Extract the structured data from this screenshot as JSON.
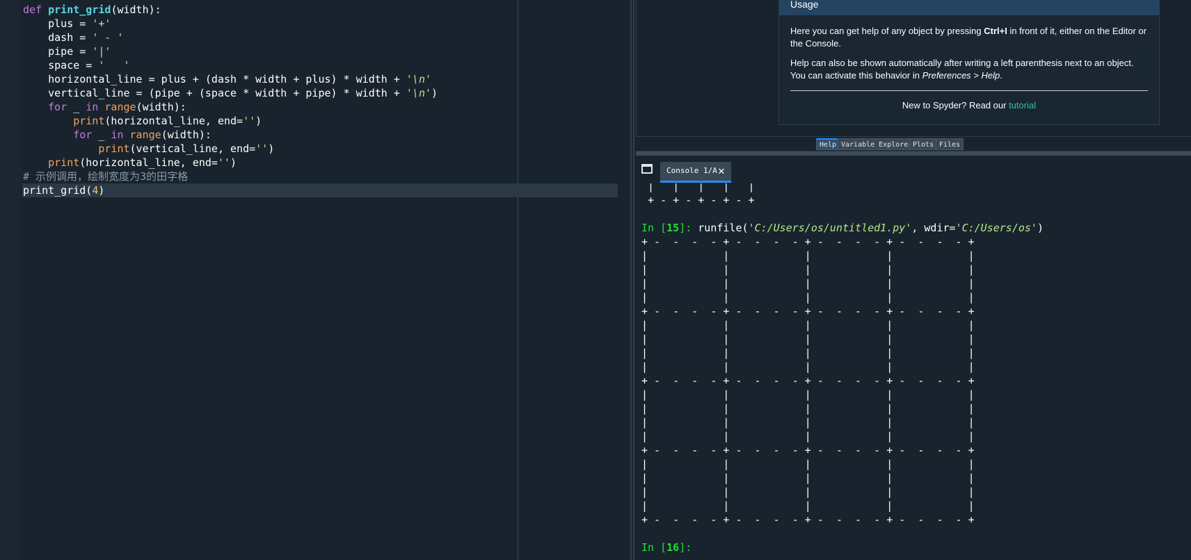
{
  "editor": {
    "lines": [
      [
        {
          "t": "def ",
          "c": "kw"
        },
        {
          "t": "print_grid",
          "c": "fn"
        },
        {
          "t": "(width):",
          "c": ""
        }
      ],
      [
        {
          "t": "    plus = ",
          "c": ""
        },
        {
          "t": "'+'",
          "c": "str"
        }
      ],
      [
        {
          "t": "    dash = ",
          "c": ""
        },
        {
          "t": "' - '",
          "c": "str"
        }
      ],
      [
        {
          "t": "    pipe = ",
          "c": ""
        },
        {
          "t": "'|'",
          "c": "str"
        }
      ],
      [
        {
          "t": "    space = ",
          "c": ""
        },
        {
          "t": "'   '",
          "c": "str"
        }
      ],
      [
        {
          "t": "    horizontal_line = plus + (dash * width + plus) * width + ",
          "c": ""
        },
        {
          "t": "'\\n'",
          "c": "str"
        }
      ],
      [
        {
          "t": "    vertical_line = (pipe + (space * width + pipe) * width + ",
          "c": ""
        },
        {
          "t": "'\\n'",
          "c": "str"
        },
        {
          "t": ")",
          "c": ""
        }
      ],
      [
        {
          "t": "    ",
          "c": ""
        },
        {
          "t": "for",
          "c": "kw"
        },
        {
          "t": " _ ",
          "c": ""
        },
        {
          "t": "in",
          "c": "kw"
        },
        {
          "t": " ",
          "c": ""
        },
        {
          "t": "range",
          "c": "bi"
        },
        {
          "t": "(width):",
          "c": ""
        }
      ],
      [
        {
          "t": "        ",
          "c": ""
        },
        {
          "t": "print",
          "c": "bi"
        },
        {
          "t": "(horizontal_line, end=",
          "c": ""
        },
        {
          "t": "''",
          "c": "str"
        },
        {
          "t": ")",
          "c": ""
        }
      ],
      [
        {
          "t": "        ",
          "c": ""
        },
        {
          "t": "for",
          "c": "kw"
        },
        {
          "t": " _ ",
          "c": ""
        },
        {
          "t": "in",
          "c": "kw"
        },
        {
          "t": " ",
          "c": ""
        },
        {
          "t": "range",
          "c": "bi"
        },
        {
          "t": "(width):",
          "c": ""
        }
      ],
      [
        {
          "t": "            ",
          "c": ""
        },
        {
          "t": "print",
          "c": "bi"
        },
        {
          "t": "(vertical_line, end=",
          "c": ""
        },
        {
          "t": "''",
          "c": "str"
        },
        {
          "t": ")",
          "c": ""
        }
      ],
      [
        {
          "t": "    ",
          "c": ""
        },
        {
          "t": "print",
          "c": "bi"
        },
        {
          "t": "(horizontal_line, end=",
          "c": ""
        },
        {
          "t": "''",
          "c": "str"
        },
        {
          "t": ")",
          "c": ""
        }
      ],
      [
        {
          "t": "# 示例调用，绘制宽度为3的田字格",
          "c": "cm"
        }
      ],
      [
        {
          "t": "print_grid(",
          "c": ""
        },
        {
          "t": "4",
          "c": "num"
        },
        {
          "t": ")",
          "c": ""
        }
      ]
    ],
    "current_line_index": 13
  },
  "help": {
    "title": "Usage",
    "p1_before": "Here you can get help of any object by pressing ",
    "p1_bold": "Ctrl+I",
    "p1_after": " in front of it, either on the Editor or the Console.",
    "p2_before": "Help can also be shown automatically after writing a left parenthesis next to an object. You can activate this behavior in ",
    "p2_italic": "Preferences > Help",
    "p2_after": ".",
    "new_prefix": "New to Spyder? Read our ",
    "new_link": "tutorial"
  },
  "pane_tabs": [
    "Help",
    "Variable Explorer",
    "Plots",
    "Files"
  ],
  "console": {
    "tab_label": "Console 1/A",
    "prev_lines": [
      " |   |   |   |   |",
      " + - + - + - + - +"
    ],
    "prompt15_label": "In [",
    "prompt15_num": "15",
    "prompt15_end": "]: ",
    "cmd_before": "runfile(",
    "cmd_arg1": "'C:/Users/os/untitled1.py'",
    "cmd_mid": ", wdir=",
    "cmd_arg2": "'C:/Users/os'",
    "cmd_after": ")",
    "grid_border": "+ -  -  -  - + -  -  -  - + -  -  -  - + -  -  -  - +",
    "grid_row": "|            |            |            |            |",
    "prompt16_label": "In [",
    "prompt16_num": "16",
    "prompt16_end": "]: "
  }
}
